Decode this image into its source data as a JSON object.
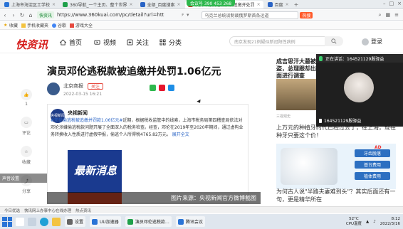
{
  "browser": {
    "tabs": [
      {
        "label": "上海市海淀区工学校",
        "color": "#2a74d6",
        "active": false
      },
      {
        "label": "360导航_一个主页、整个世界",
        "color": "#1fa04a",
        "active": false
      },
      {
        "label": "全部_百度搜索",
        "color": "#2a64c5",
        "active": false
      },
      {
        "label": "演员邓伦偷逃税款被追缴并处罚",
        "color": "#d6201e",
        "active": true
      },
      {
        "label": "百度",
        "color": "#2a64c5",
        "active": false
      }
    ],
    "top_pill": "会议号 390 453 268",
    "secure_label": "快资讯",
    "url": "https://www.360kuai.com/pc/detail?url=htt",
    "search_text": "乌克兰总统谈制裁俄罗斯首条运道",
    "hot_label": "热搜",
    "bookmarks": [
      "收藏",
      "手机收藏夹",
      "谷歌",
      "游戏大全"
    ]
  },
  "site": {
    "logo": "快资讯",
    "nav": [
      {
        "label": "首页",
        "icon": "home-icon"
      },
      {
        "label": "视频",
        "icon": "video-icon"
      },
      {
        "label": "关注",
        "icon": "follow-icon"
      },
      {
        "label": "分类",
        "icon": "category-icon"
      }
    ],
    "search_placeholder": "南京发现21例疑似新冠阳性病例",
    "login_label": "登录"
  },
  "article": {
    "title": "演员邓伦逃税款被追缴并处罚1.06亿元",
    "author": "北京商报",
    "follow_label": "关注",
    "date": "2022-03-15 16:21",
    "rail": [
      {
        "label": "1",
        "icon": "like-icon"
      },
      {
        "label": "评论",
        "icon": "comment-icon"
      },
      {
        "label": "收藏",
        "icon": "star-icon"
      },
      {
        "label": "分享",
        "icon": "share-icon"
      }
    ],
    "weibo_name": "央视新闻",
    "weibo_avatar_text": "央视新闻",
    "weibo_tag": "#邓伦偷逃税被追缴并罚款1.06亿元#",
    "weibo_text": "近期，根据税收监管中的线索，上海市税务局第四稽查局依法对邓伦涉嫌偷逃税款问题开展了全面深入的税务检查。经查，邓伦在2019年至2020年期间，通过虚构业务转换收入性质进行虚假申报，偷逃个人所得税4765.82万元。",
    "expand_label": "展开全文",
    "image_text": "最新消息",
    "image_credit": "图片来源：央视新闻官方微博截图"
  },
  "right": {
    "title": "成吉思汗大墓被盗，总理跟却出面进行调查",
    "source": "三视观史",
    "headline2": "上万元的种植牙时代已经过去了，在上海，现在种牙只要这个价！",
    "ad_buttons": [
      "牙齿脱落",
      "基台费用",
      "植体费用"
    ],
    "ad_stamp": "AD",
    "bottom_text": "为何古人说\"半路夫妻难到头\"？其实后面还有一句，更是精华所在"
  },
  "meeting": {
    "status": "正在讲话：164521129殷驿益",
    "name": "164521129殷驿益"
  },
  "float_chip": "声音设置",
  "statusbar": [
    "今日优选",
    "快讯网上办事中心在线办理",
    "热点资讯"
  ],
  "taskbar": {
    "apps": [
      {
        "label": "设置",
        "color": "#666666"
      },
      {
        "label": "UU加速器",
        "color": "#2a74d6"
      },
      {
        "label": "演员邓伦逃税款…",
        "color": "#1fa04a"
      },
      {
        "label": "腾讯会议",
        "color": "#2a74d6"
      }
    ],
    "temp": "52°C",
    "cpu": "CPU温度",
    "time": "8:12",
    "date": "2022/3/16"
  }
}
